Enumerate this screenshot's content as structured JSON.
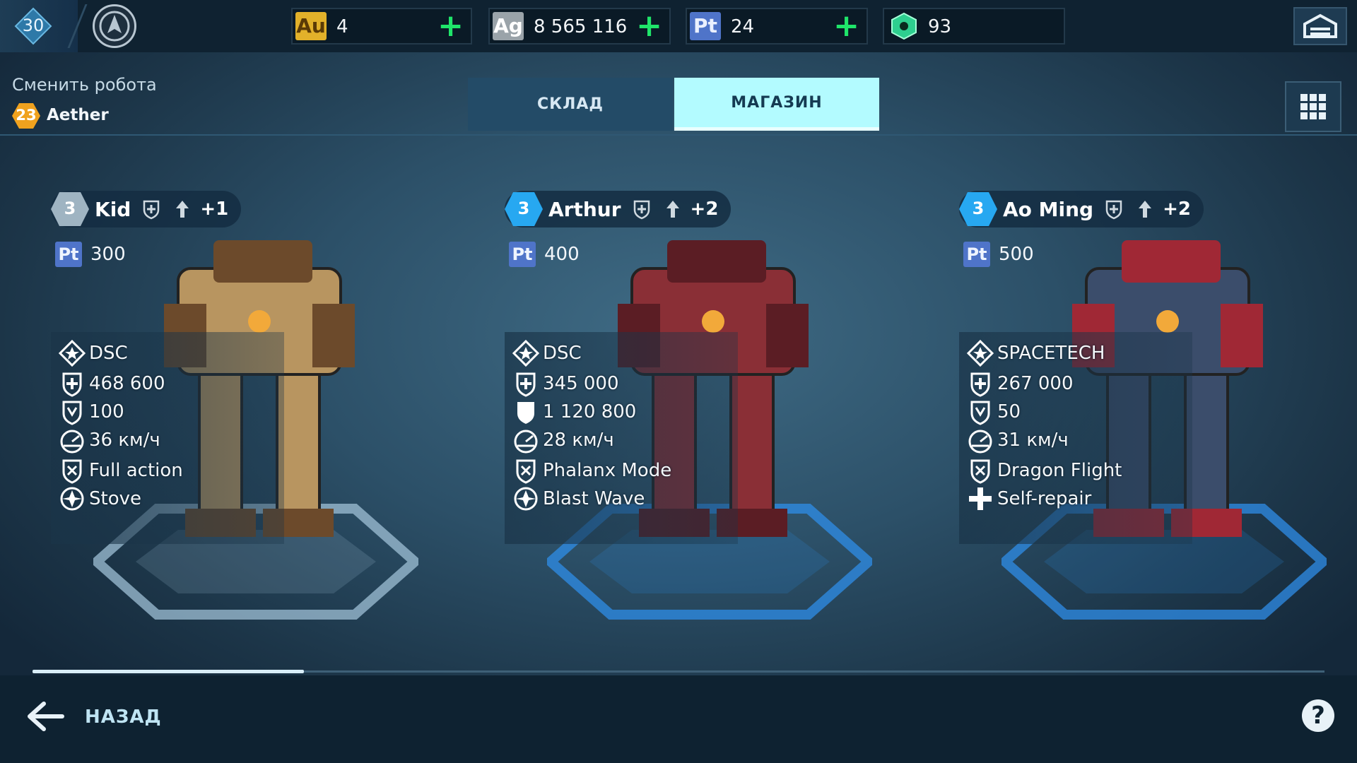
{
  "player": {
    "level": "30"
  },
  "resources": [
    {
      "badge": "Au",
      "value": "4",
      "color": "#e2b12a"
    },
    {
      "badge": "Ag",
      "value": "8 565 116",
      "color": "#9aa3a9"
    },
    {
      "badge": "Pt",
      "value": "24",
      "color": "#4f74c9"
    },
    {
      "badge": "",
      "value": "93",
      "color": "#2ecf8f"
    }
  ],
  "header": {
    "change_robot": "Сменить робота",
    "current_level": "23",
    "current_robot": "Aether"
  },
  "tabs": {
    "storage": "СКЛАД",
    "shop": "МАГАЗИН",
    "active": "shop"
  },
  "robots": [
    {
      "name": "Kid",
      "level": "3",
      "extra": "+1",
      "price": "300",
      "stats": [
        "DSC",
        "468 600",
        "100",
        "36 км/ч",
        "Full action",
        "Stove"
      ],
      "icons": [
        "faction-icon",
        "health-icon",
        "armor-icon",
        "speed-icon",
        "ability-icon",
        "ability2-icon"
      ],
      "body_color": "#b89560",
      "accent": "#6c4a2b",
      "level_color": "#9fb4c2"
    },
    {
      "name": "Arthur",
      "level": "3",
      "extra": "+2",
      "price": "400",
      "stats": [
        "DSC",
        "345 000",
        "1 120 800",
        "28 км/ч",
        "Phalanx Mode",
        "Blast Wave"
      ],
      "icons": [
        "faction-icon",
        "health-icon",
        "shield-icon",
        "speed-icon",
        "ability-icon",
        "ability2-icon"
      ],
      "body_color": "#8a2f36",
      "accent": "#5b1d24",
      "level_color": "#27a8f1"
    },
    {
      "name": "Ao Ming",
      "level": "3",
      "extra": "+2",
      "price": "500",
      "stats": [
        "SPACETECH",
        "267 000",
        "50",
        "31 км/ч",
        "Dragon Flight",
        "Self-repair"
      ],
      "icons": [
        "faction-icon",
        "health-icon",
        "armor-icon",
        "speed-icon",
        "ability-icon",
        "repair-icon"
      ],
      "body_color": "#3b4d6b",
      "accent": "#a02835",
      "level_color": "#27a8f1"
    }
  ],
  "footer": {
    "back": "НАЗАД",
    "help": "?"
  }
}
